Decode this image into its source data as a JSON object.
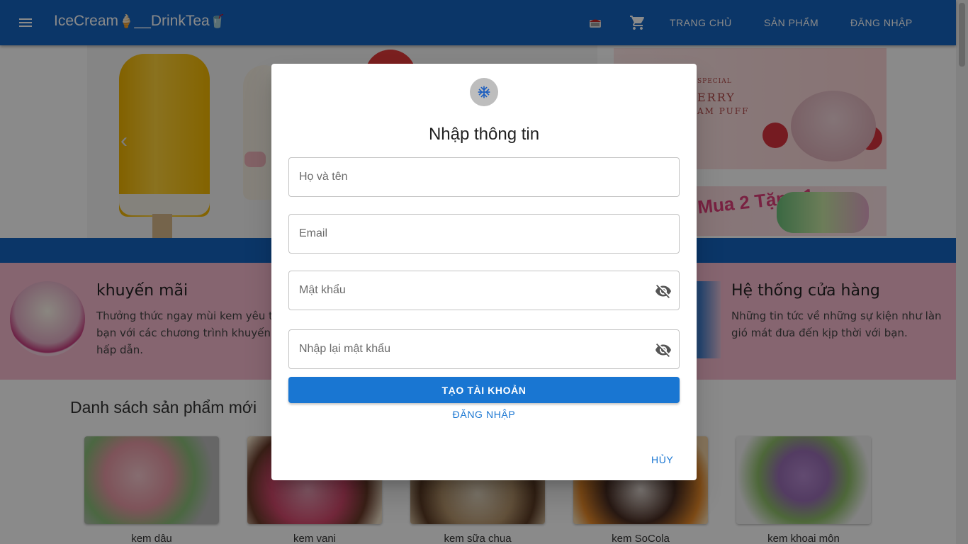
{
  "appbar": {
    "title": "IceCream",
    "title_emoji_1": "🍦",
    "title_sep": "__",
    "title_part2": "DrinkTea",
    "title_emoji_2": "🥤",
    "nav": [
      "TRANG CHỦ",
      "SẢN PHẨM",
      "ĐĂNG NHẬP"
    ],
    "icons": [
      "menu-icon",
      "mailbox-icon",
      "cart-icon"
    ]
  },
  "banners": {
    "banner1_line1": "SPECIAL",
    "banner1_line2": "ERRY",
    "banner1_line3": "AM PUFF",
    "banner2_text": "Mua 2 Tặng 1"
  },
  "features": {
    "promo": {
      "title": "khuyến mãi",
      "desc_lines": [
        "Thưởng thức ngay mùi kem yêu thí",
        "bạn với các chương trình khuyến m",
        "hấp dẫn."
      ]
    },
    "stores": {
      "title": "Hệ thống cửa hàng",
      "desc_lines": [
        "Những tin tức về những sự kiện như làn",
        "gió mát đưa đến kịp thời với bạn."
      ]
    }
  },
  "product_list": {
    "title": "Danh sách sản phẩm mới",
    "items": [
      {
        "name": "kem dâu"
      },
      {
        "name": "kem vani"
      },
      {
        "name": "kem sữa chua"
      },
      {
        "name": "kem SoCola"
      },
      {
        "name": "kem khoai môn"
      }
    ]
  },
  "dialog": {
    "avatar_icon": "snowflake-icon",
    "title": "Nhập thông tin",
    "fields": {
      "fullname": {
        "placeholder": "Họ và tên",
        "value": ""
      },
      "email": {
        "placeholder": "Email",
        "value": ""
      },
      "password": {
        "placeholder": "Mật khẩu",
        "value": ""
      },
      "password_confirm": {
        "placeholder": "Nhập lại mật khẩu",
        "value": ""
      }
    },
    "create_label": "TẠO TÀI KHOẢN",
    "login_label": "ĐĂNG NHẬP",
    "cancel_label": "HỦY"
  },
  "colors": {
    "primary": "#1565c0",
    "button": "#1976d2",
    "pink": "#f8bbd0"
  }
}
